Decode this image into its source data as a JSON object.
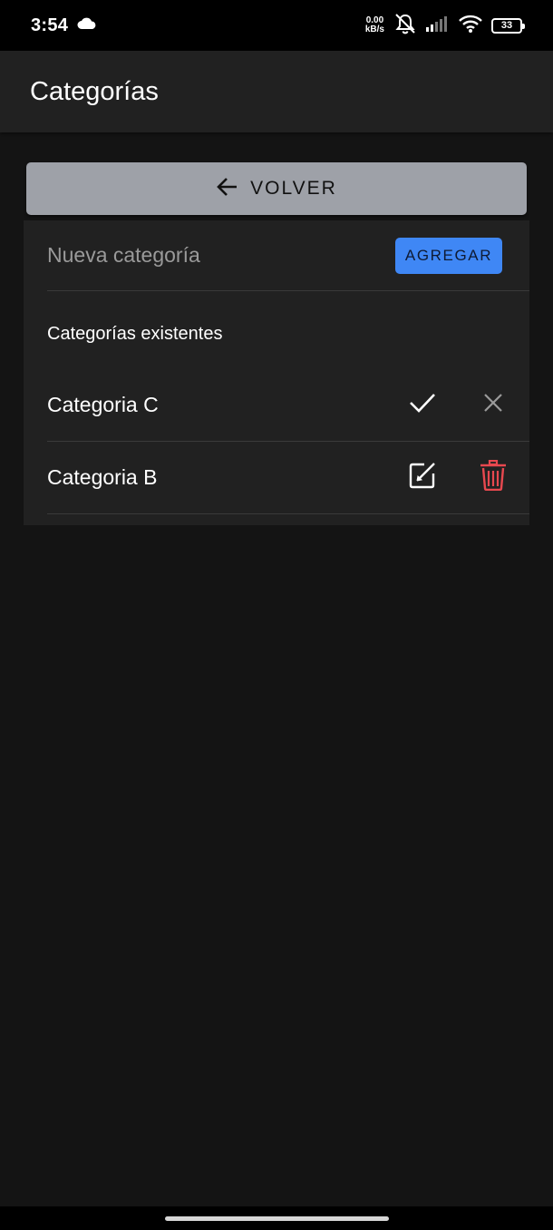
{
  "status_bar": {
    "time": "3:54",
    "speed_value": "0.00",
    "speed_unit": "kB/s",
    "battery": "33"
  },
  "appbar": {
    "title": "Categorías"
  },
  "back_button": {
    "label": "VOLVER",
    "icon": "arrow-left-icon"
  },
  "new_category": {
    "placeholder": "Nueva categoría",
    "value": "",
    "add_label": "AGREGAR"
  },
  "existing": {
    "title": "Categorías existentes",
    "items": [
      {
        "name": "Categoria C",
        "mode": "editing",
        "action1_icon": "check-icon",
        "action2_icon": "close-icon"
      },
      {
        "name": "Categoria B",
        "mode": "view",
        "action1_icon": "edit-icon",
        "action2_icon": "trash-icon"
      }
    ]
  },
  "colors": {
    "background": "#141414",
    "surface": "#212121",
    "back_button": "#9ea1a8",
    "accent": "#3f87f5",
    "danger": "#e8484f"
  }
}
